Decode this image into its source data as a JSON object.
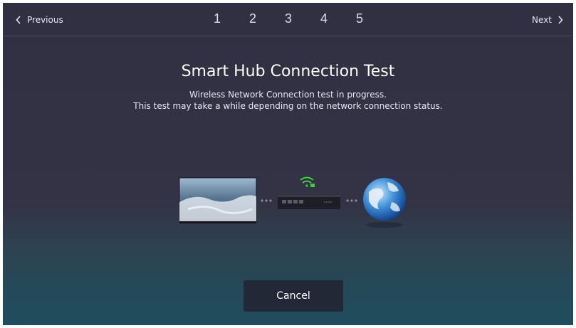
{
  "nav": {
    "previous_label": "Previous",
    "next_label": "Next",
    "steps": [
      "1",
      "2",
      "3",
      "4",
      "5"
    ]
  },
  "page": {
    "title": "Smart Hub Connection Test",
    "subtitle_line1": "Wireless Network Connection test in progress.",
    "subtitle_line2": "This test may take a while depending on the network connection status."
  },
  "illustration": {
    "nodes": [
      "tv-icon",
      "router-icon",
      "globe-icon"
    ],
    "wifi_icon": "wifi-signal-icon",
    "wifi_color": "#3ccf3c"
  },
  "actions": {
    "cancel_label": "Cancel"
  },
  "colors": {
    "background_top": "#303042",
    "background_bottom": "#1f4d5e",
    "button_bg": "#232836"
  }
}
